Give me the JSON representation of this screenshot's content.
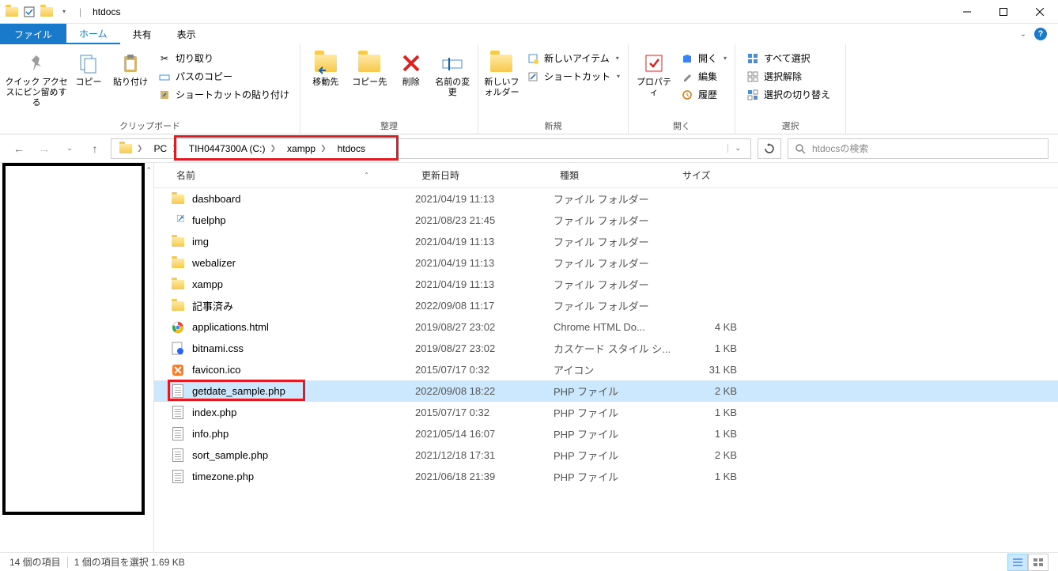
{
  "window": {
    "title": "htdocs",
    "min": "—",
    "max": "☐",
    "close": "✕"
  },
  "tabs": {
    "file": "ファイル",
    "home": "ホーム",
    "share": "共有",
    "view": "表示"
  },
  "ribbon": {
    "clipboard": {
      "pin": "クイック アクセスにピン留めする",
      "copy": "コピー",
      "paste": "貼り付け",
      "cut": "切り取り",
      "copy_path": "パスのコピー",
      "paste_shortcut": "ショートカットの貼り付け",
      "label": "クリップボード"
    },
    "organize": {
      "move_to": "移動先",
      "copy_to": "コピー先",
      "delete": "削除",
      "rename": "名前の変更",
      "label": "整理"
    },
    "new": {
      "new_folder": "新しいフォルダー",
      "new_item": "新しいアイテム",
      "shortcut": "ショートカット",
      "label": "新規"
    },
    "open": {
      "properties": "プロパティ",
      "open": "開く",
      "edit": "編集",
      "history": "履歴",
      "label": "開く"
    },
    "select": {
      "select_all": "すべて選択",
      "select_none": "選択解除",
      "invert": "選択の切り替え",
      "label": "選択"
    }
  },
  "breadcrumb": {
    "pc": "PC",
    "drive": "TIH0447300A (C:)",
    "xampp": "xampp",
    "htdocs": "htdocs"
  },
  "search": {
    "placeholder": "htdocsの検索"
  },
  "columns": {
    "name": "名前",
    "date": "更新日時",
    "type": "種類",
    "size": "サイズ"
  },
  "files": [
    {
      "icon": "folder",
      "name": "dashboard",
      "date": "2021/04/19 11:13",
      "type": "ファイル フォルダー",
      "size": ""
    },
    {
      "icon": "shortcut",
      "name": "fuelphp",
      "date": "2021/08/23 21:45",
      "type": "ファイル フォルダー",
      "size": ""
    },
    {
      "icon": "folder",
      "name": "img",
      "date": "2021/04/19 11:13",
      "type": "ファイル フォルダー",
      "size": ""
    },
    {
      "icon": "folder",
      "name": "webalizer",
      "date": "2021/04/19 11:13",
      "type": "ファイル フォルダー",
      "size": ""
    },
    {
      "icon": "folder",
      "name": "xampp",
      "date": "2021/04/19 11:13",
      "type": "ファイル フォルダー",
      "size": ""
    },
    {
      "icon": "folder",
      "name": "記事済み",
      "date": "2022/09/08 11:17",
      "type": "ファイル フォルダー",
      "size": ""
    },
    {
      "icon": "chrome",
      "name": "applications.html",
      "date": "2019/08/27 23:02",
      "type": "Chrome HTML Do...",
      "size": "4 KB"
    },
    {
      "icon": "css",
      "name": "bitnami.css",
      "date": "2019/08/27 23:02",
      "type": "カスケード スタイル シ...",
      "size": "1 KB"
    },
    {
      "icon": "xampp",
      "name": "favicon.ico",
      "date": "2015/07/17 0:32",
      "type": "アイコン",
      "size": "31 KB"
    },
    {
      "icon": "file",
      "name": "getdate_sample.php",
      "date": "2022/09/08 18:22",
      "type": "PHP ファイル",
      "size": "2 KB",
      "selected": true,
      "highlight": true
    },
    {
      "icon": "file",
      "name": "index.php",
      "date": "2015/07/17 0:32",
      "type": "PHP ファイル",
      "size": "1 KB"
    },
    {
      "icon": "file",
      "name": "info.php",
      "date": "2021/05/14 16:07",
      "type": "PHP ファイル",
      "size": "1 KB"
    },
    {
      "icon": "file",
      "name": "sort_sample.php",
      "date": "2021/12/18 17:31",
      "type": "PHP ファイル",
      "size": "2 KB"
    },
    {
      "icon": "file",
      "name": "timezone.php",
      "date": "2021/06/18 21:39",
      "type": "PHP ファイル",
      "size": "1 KB"
    }
  ],
  "status": {
    "count": "14 個の項目",
    "selection": "1 個の項目を選択 1.69 KB"
  }
}
